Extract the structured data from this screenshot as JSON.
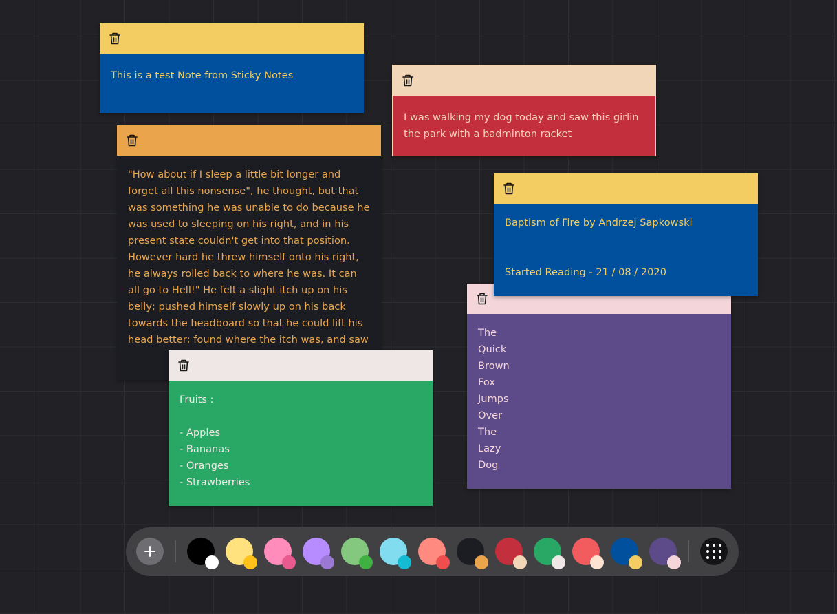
{
  "notes": [
    {
      "name": "note-test",
      "header_color": "#f3cd61",
      "body_color": "#00509d",
      "text_color": "#f3cd61",
      "text": "This is a test Note from Sticky Notes"
    },
    {
      "name": "note-dog-walk",
      "header_color": "#f1d6b8",
      "body_color": "#c32f3c",
      "text_color": "#f1d6b8",
      "text": "I was walking my dog today and saw this girlin the park with a badminton racket"
    },
    {
      "name": "note-story",
      "header_color": "#e9a44c",
      "body_color": "#1b1d22",
      "text_color": "#e9a44c",
      "text": "\"How about if I sleep a little bit longer and forget all this nonsense\", he thought, but that was something he was unable to do because he was used to sleeping on his right, and in his present state couldn't get into that position. However hard he threw himself onto his right, he always rolled back to where he was. It can all go to Hell!\" He felt a slight itch up on his belly; pushed himself slowly up on his back towards the headboard so that he could lift his head better; found where the itch was, and saw"
    },
    {
      "name": "note-pangram",
      "header_color": "#f4d6da",
      "body_color": "#5c4a89",
      "text_color": "#f4d6da",
      "text": "The\nQuick\nBrown\nFox\nJumps\nOver\nThe\nLazy\nDog"
    },
    {
      "name": "note-book",
      "header_color": "#f3cd61",
      "body_color": "#00509d",
      "text_color": "#f3cd61",
      "text": "Baptism of Fire by Andrzej Sapkowski\n\n\nStarted Reading - 21 / 08 / 2020"
    },
    {
      "name": "note-fruits",
      "header_color": "#efe7e6",
      "body_color": "#29a764",
      "text_color": "#efe7e6",
      "text": "Fruits :\n\n- Apples\n- Bananas\n- Oranges\n- Strawberries"
    }
  ],
  "toolbar": {
    "add_icon": "plus-icon",
    "menu_icon": "grid-dots-icon",
    "swatches": [
      {
        "main": "#000000",
        "accent": "#ffffff"
      },
      {
        "main": "#ffe17d",
        "accent": "#ffc21a"
      },
      {
        "main": "#ff8cba",
        "accent": "#e95a8f"
      },
      {
        "main": "#b68cff",
        "accent": "#9a78d3"
      },
      {
        "main": "#83c87e",
        "accent": "#40b043"
      },
      {
        "main": "#81dcef",
        "accent": "#13bcd3"
      },
      {
        "main": "#ff8a80",
        "accent": "#f04e4e"
      },
      {
        "main": "#1b1d22",
        "accent": "#e9a44c"
      },
      {
        "main": "#c32f3c",
        "accent": "#f1d6b8"
      },
      {
        "main": "#29a764",
        "accent": "#efe7e6"
      },
      {
        "main": "#f25c5f",
        "accent": "#fde4d2"
      },
      {
        "main": "#00509d",
        "accent": "#f3cd61"
      },
      {
        "main": "#5c4a89",
        "accent": "#f4d6da"
      }
    ]
  }
}
